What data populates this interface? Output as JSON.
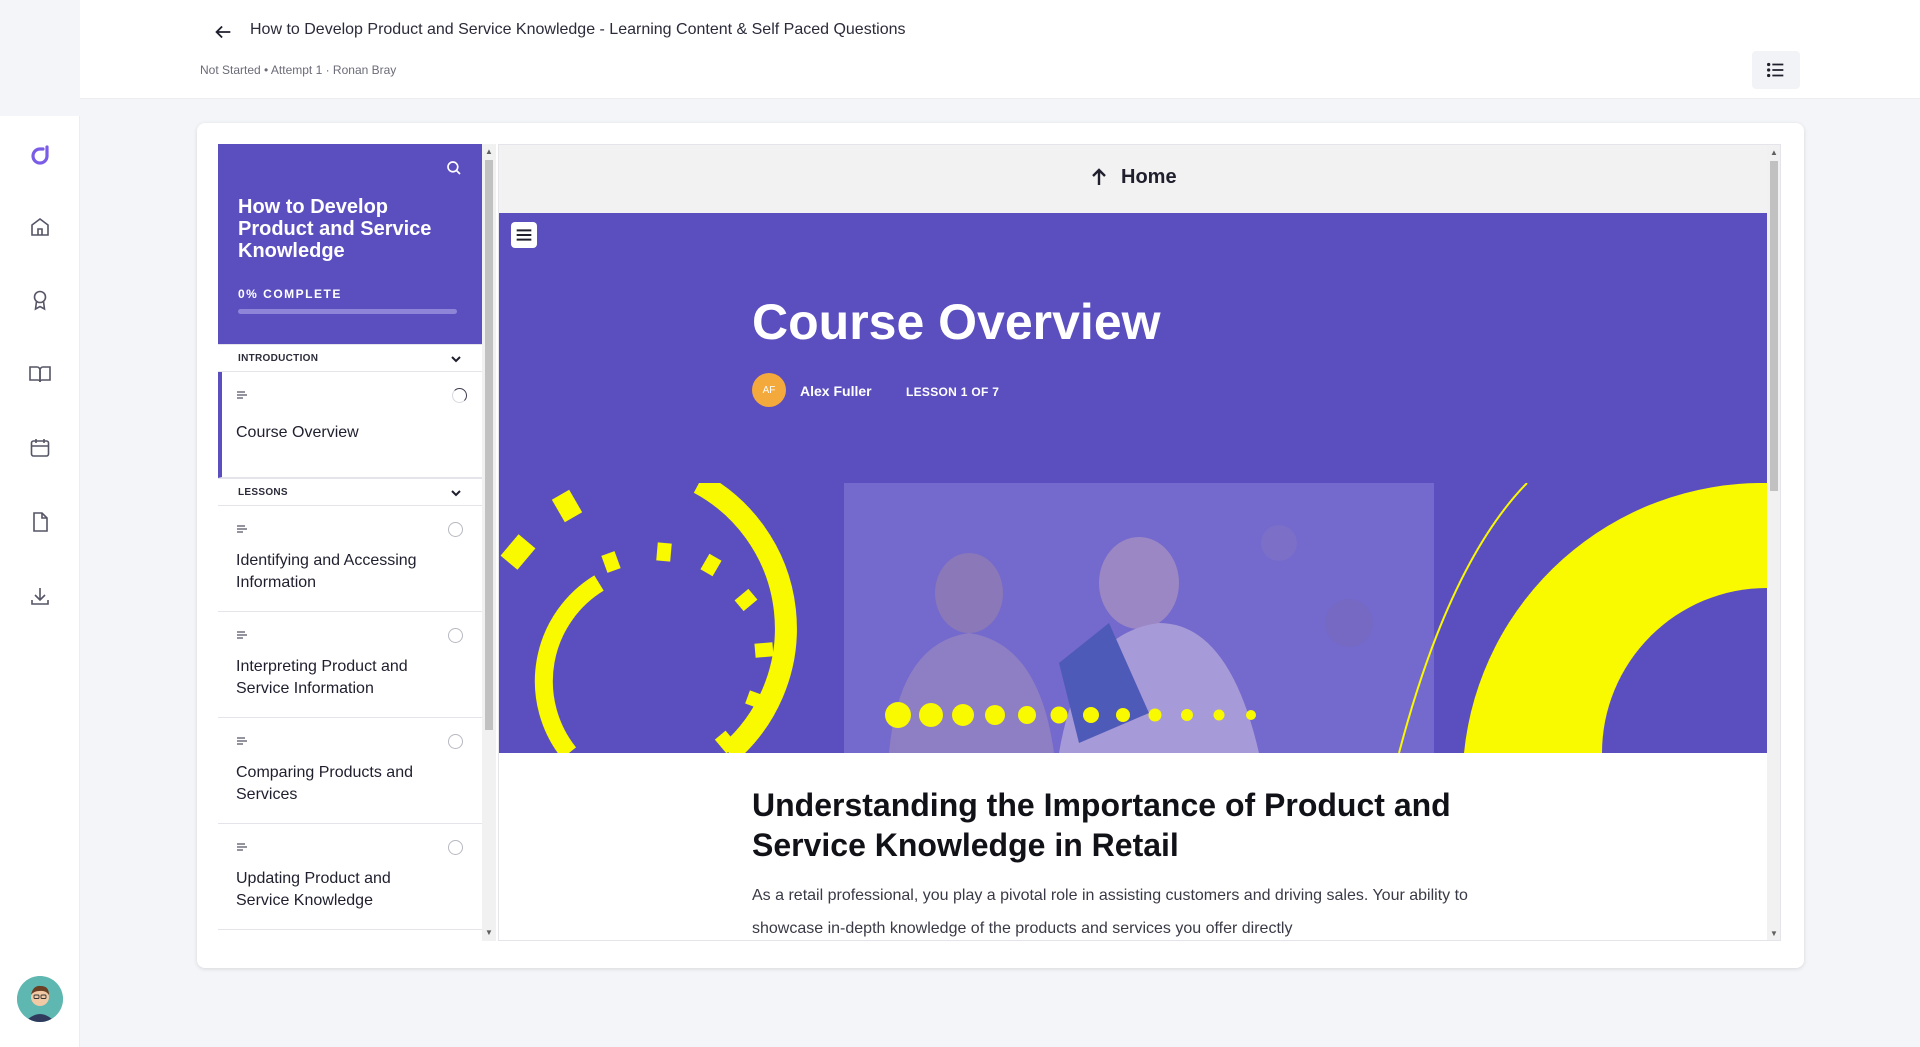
{
  "header": {
    "title": "How to Develop Product and Service Knowledge - Learning Content & Self Paced Questions",
    "meta": "Not Started • Attempt 1 · Ronan Bray"
  },
  "rail": {
    "icons": [
      "logo-icon",
      "home-icon",
      "award-icon",
      "book-icon",
      "calendar-icon",
      "file-icon",
      "download-icon"
    ]
  },
  "sidebar": {
    "course_title": "How to Develop Product and Service Knowledge",
    "progress_label": "0% COMPLETE",
    "progress": 0,
    "sections": [
      {
        "label": "INTRODUCTION",
        "items": [
          {
            "label": "Course Overview",
            "status": "in-progress"
          }
        ]
      },
      {
        "label": "LESSONS",
        "items": [
          {
            "label": "Identifying and Accessing Information",
            "status": "not-started"
          },
          {
            "label": "Interpreting Product and Service Information",
            "status": "not-started"
          },
          {
            "label": "Comparing Products and Services",
            "status": "not-started"
          },
          {
            "label": "Updating Product and Service Knowledge",
            "status": "not-started"
          }
        ]
      }
    ]
  },
  "content": {
    "home_label": "Home",
    "hero_title": "Course Overview",
    "author_initials": "AF",
    "author_name": "Alex Fuller",
    "lesson_count": "LESSON 1 OF 7",
    "heading": "Understanding the Importance of Product and Service Knowledge in Retail",
    "body": "As a retail professional, you play a pivotal role in assisting customers and driving sales. Your ability to showcase in-depth knowledge of the products and services you offer directly"
  },
  "colors": {
    "accent": "#5b4fc0",
    "hero_yellow": "#f9f900",
    "author_avatar": "#f4a93c"
  }
}
